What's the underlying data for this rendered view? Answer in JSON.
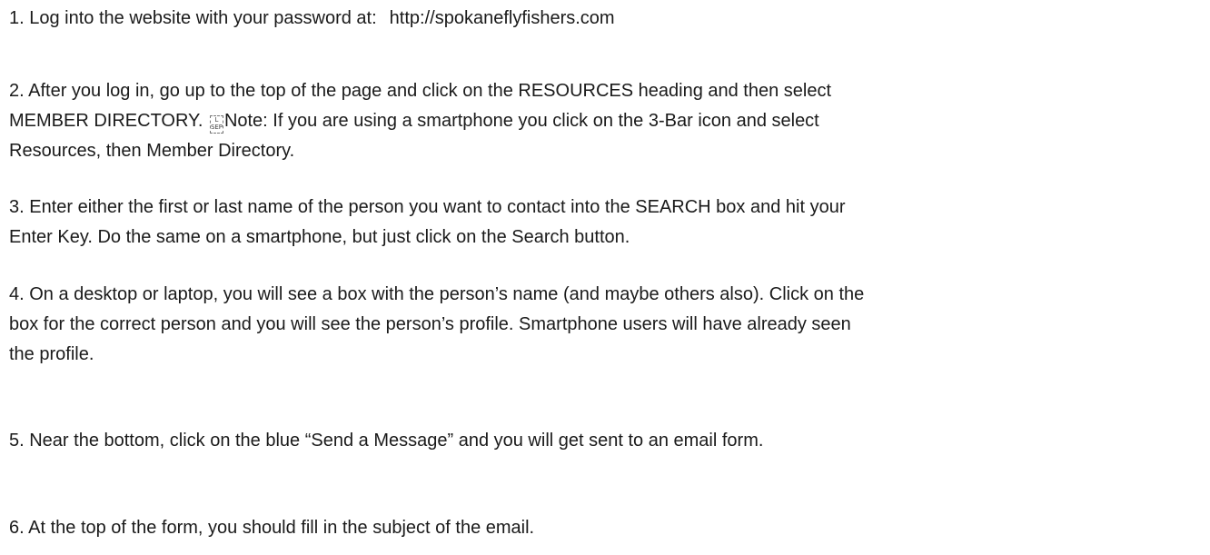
{
  "document": {
    "step1": {
      "text": "1.  Log into the website with your password at:",
      "url": "http://spokaneflyfishers.com"
    },
    "step2": {
      "line1": "2.  After you log in, go up to the top of the page and click on the RESOURCES heading and then select",
      "line2_before": "MEMBER DIRECTORY. ",
      "sep_glyph": "L SEP",
      "line2_after": "Note:  If you are using a smartphone you click on the 3-Bar icon and select",
      "line3": "Resources, then Member Directory."
    },
    "step3": {
      "line1": "3.  Enter either the first or last name of the person you want to contact into the SEARCH box and hit your",
      "line2": "Enter Key.  Do the same on a smartphone, but just click on the Search button."
    },
    "step4": {
      "line1": "4.  On a desktop or laptop, you will see a box with the person’s name (and maybe others also). Click on the",
      "line2": "box for the correct person and you will see the person’s profile.  Smartphone users will have already seen",
      "line3": "the profile."
    },
    "step5": {
      "text": "5.  Near the bottom, click on the blue “Send a Message” and you will get sent to an email form."
    },
    "step6": {
      "text": "6.  At the top of the form, you should fill in the subject of the email."
    }
  }
}
